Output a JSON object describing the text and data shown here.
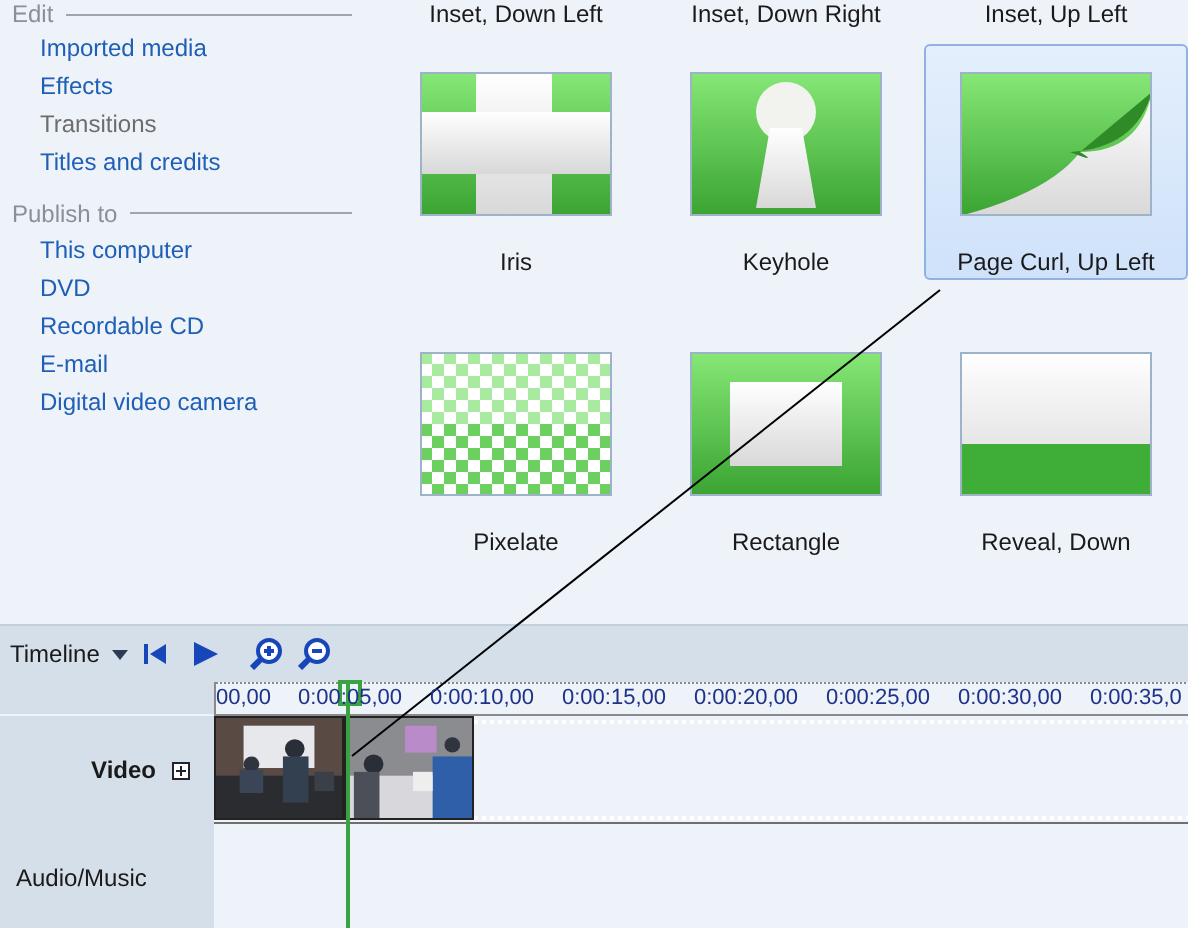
{
  "sidebar": {
    "sections": [
      {
        "heading": "Edit",
        "items": [
          {
            "label": "Imported media",
            "selected": false
          },
          {
            "label": "Effects",
            "selected": false
          },
          {
            "label": "Transitions",
            "selected": true
          },
          {
            "label": "Titles and credits",
            "selected": false
          }
        ]
      },
      {
        "heading": "Publish to",
        "items": [
          {
            "label": "This computer",
            "selected": false
          },
          {
            "label": "DVD",
            "selected": false
          },
          {
            "label": "Recordable CD",
            "selected": false
          },
          {
            "label": "E-mail",
            "selected": false
          },
          {
            "label": "Digital video camera",
            "selected": false
          }
        ]
      }
    ]
  },
  "transitions_above": [
    "Inset, Down Left",
    "Inset, Down Right",
    "Inset, Up Left"
  ],
  "transitions": [
    {
      "label": "Iris",
      "kind": "iris",
      "selected": false
    },
    {
      "label": "Keyhole",
      "kind": "keyhole",
      "selected": false
    },
    {
      "label": "Page Curl, Up Left",
      "kind": "page-curl",
      "selected": true
    },
    {
      "label": "Pixelate",
      "kind": "pixelate",
      "selected": false
    },
    {
      "label": "Rectangle",
      "kind": "rectangle",
      "selected": false
    },
    {
      "label": "Reveal, Down",
      "kind": "reveal-down",
      "selected": false
    }
  ],
  "timeline": {
    "title": "Timeline",
    "ruler": [
      "00,00",
      "0:00:05,00",
      "0:00:10,00",
      "0:00:15,00",
      "0:00:20,00",
      "0:00:25,00",
      "0:00:30,00",
      "0:00:35,0"
    ],
    "tracks": [
      {
        "label": "Video",
        "expandable": true
      },
      {
        "label": "Audio/Music",
        "expandable": false
      }
    ]
  }
}
